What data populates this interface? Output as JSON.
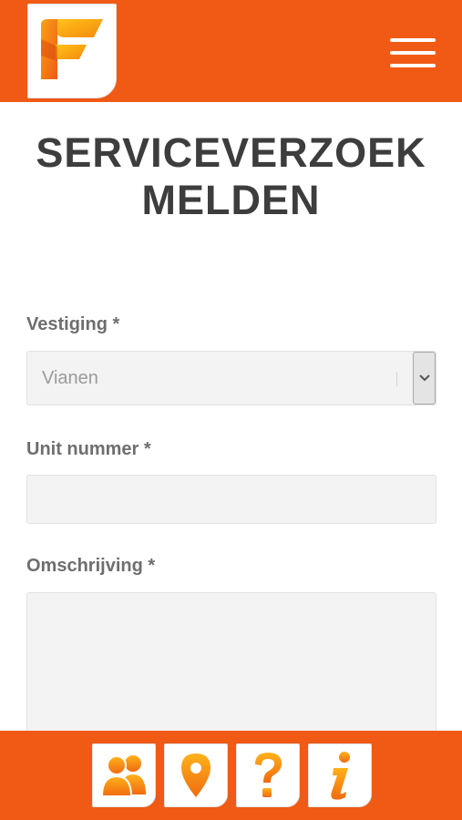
{
  "header": {
    "logo_icon": "f-logo-icon",
    "menu_icon": "hamburger-icon",
    "brand_color": "#f05a14"
  },
  "page": {
    "title_line1": "SERVICEVERZOEK",
    "title_line2": "MELDEN"
  },
  "form": {
    "vestiging": {
      "label": "Vestiging",
      "required_mark": "*",
      "value": "Vianen"
    },
    "unit_nummer": {
      "label": "Unit nummer",
      "required_mark": "*",
      "value": ""
    },
    "omschrijving": {
      "label": "Omschrijving",
      "required_mark": "*",
      "value": ""
    }
  },
  "bottom_nav": {
    "items": [
      {
        "icon": "people-icon"
      },
      {
        "icon": "location-pin-icon"
      },
      {
        "icon": "question-icon"
      },
      {
        "icon": "info-icon"
      }
    ]
  }
}
